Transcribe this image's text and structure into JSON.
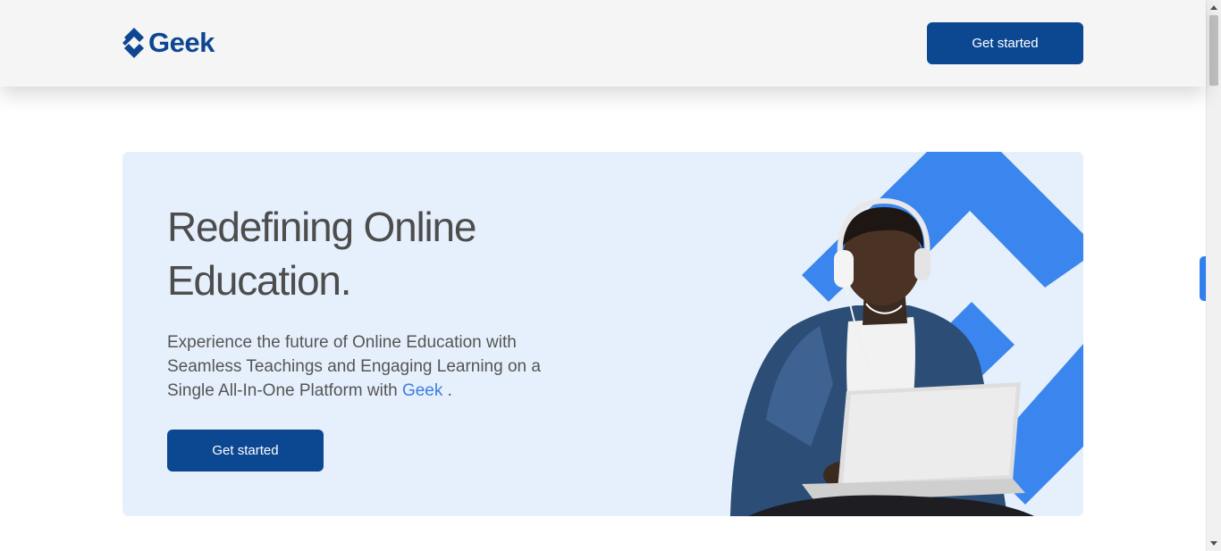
{
  "header": {
    "logo_text": "Geek",
    "cta_label": "Get started"
  },
  "hero": {
    "title": "Redefining Online Education.",
    "description_before": "Experience the future of Online Education with Seamless Teachings and Engaging Learning on a Single All-In-One Platform with ",
    "description_accent": "Geek",
    "description_after": " .",
    "cta_label": "Get started",
    "image_icon": "student-with-laptop-image"
  },
  "colors": {
    "brand": "#0c4892",
    "accent": "#3a7fe0",
    "hero_bg": "#e6f0fc",
    "shape_blue": "#3b86ee"
  }
}
